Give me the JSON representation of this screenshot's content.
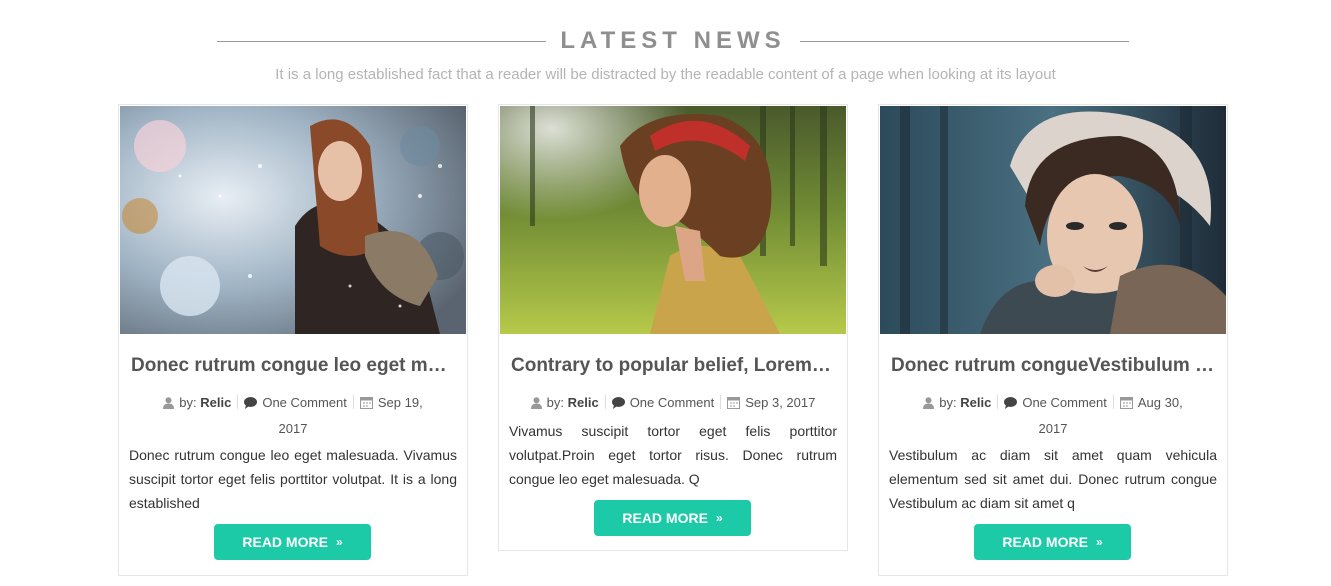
{
  "section": {
    "title": "LATEST NEWS",
    "subtitle": "It is a long established fact that a reader will be distracted by the readable content of a page when looking at its layout"
  },
  "cards": [
    {
      "title": "Donec rutrum congue leo eget malesuada",
      "by_label": "by:",
      "author": "Relic",
      "comments": "One Comment",
      "date_line1": "Sep 19,",
      "date_line2": "2017",
      "excerpt": "Donec rutrum congue leo eget malesuada. Vivamus suscipit tortor eget felis porttitor volutpat. It is a long established",
      "read_more": "READ MORE"
    },
    {
      "title": "Contrary to popular belief, Lorem Ipsum",
      "by_label": "by:",
      "author": "Relic",
      "comments": "One Comment",
      "date_line1": "Sep 3, 2017",
      "date_line2": "",
      "excerpt": "Vivamus suscipit tortor eget felis porttitor volutpat.Proin eget tortor risus. Donec rutrum congue leo eget malesuada. Q",
      "read_more": "READ MORE"
    },
    {
      "title": "Donec rutrum congueVestibulum ac diam",
      "by_label": "by:",
      "author": "Relic",
      "comments": "One Comment",
      "date_line1": "Aug 30,",
      "date_line2": "2017",
      "excerpt": "Vestibulum ac diam sit amet quam vehicula elementum sed sit amet dui. Donec rutrum congue Vestibulum ac diam sit amet q",
      "read_more": "READ MORE"
    }
  ],
  "icons": {
    "author": "user-icon",
    "comments": "comment-icon",
    "date": "calendar-icon",
    "read_more": "double-chevron-right-icon"
  },
  "colors": {
    "accent": "#1ccaa8",
    "title": "#8f8f8f",
    "subtitle": "#b4b4b4"
  }
}
